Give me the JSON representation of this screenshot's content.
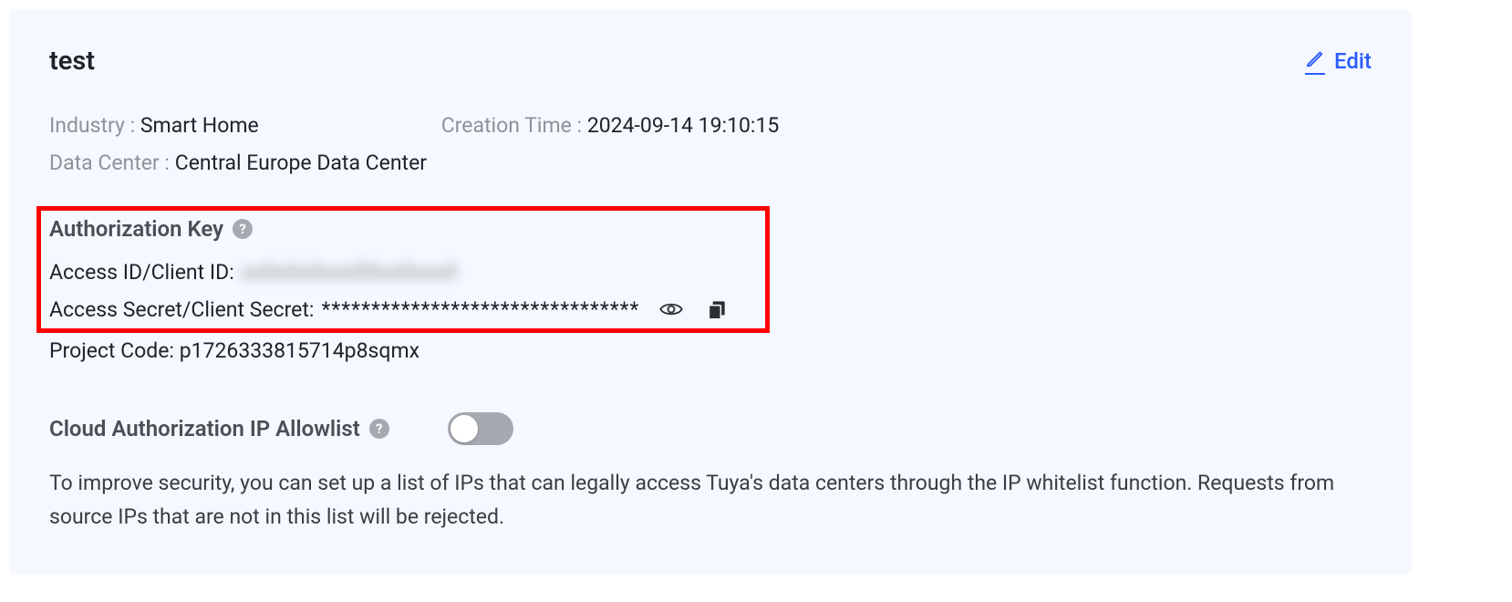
{
  "header": {
    "title": "test",
    "edit_label": "Edit"
  },
  "meta": {
    "industry_label": "Industry : ",
    "industry_value": "Smart Home",
    "creation_label": "Creation Time : ",
    "creation_value": "2024-09-14 19:10:15",
    "datacenter_label": "Data Center : ",
    "datacenter_value": "Central Europe Data Center"
  },
  "auth": {
    "section_title": "Authorization Key",
    "access_id_label": "Access ID/Client ID:",
    "access_id_value": "xx0x0x0xxx00xx0xxx0",
    "access_secret_label": "Access Secret/Client Secret:",
    "access_secret_value": "********************************",
    "project_code_label": "Project Code: ",
    "project_code_value": "p1726333815714p8sqmx"
  },
  "allowlist": {
    "title": "Cloud Authorization IP Allowlist",
    "enabled": false,
    "description": "To improve security, you can set up a list of IPs that can legally access Tuya's data centers through the IP whitelist function. Requests from source IPs that are not in this list will be rejected."
  },
  "icons": {
    "help": "?",
    "edit": "edit-icon",
    "eye": "eye-icon",
    "copy": "copy-icon"
  }
}
